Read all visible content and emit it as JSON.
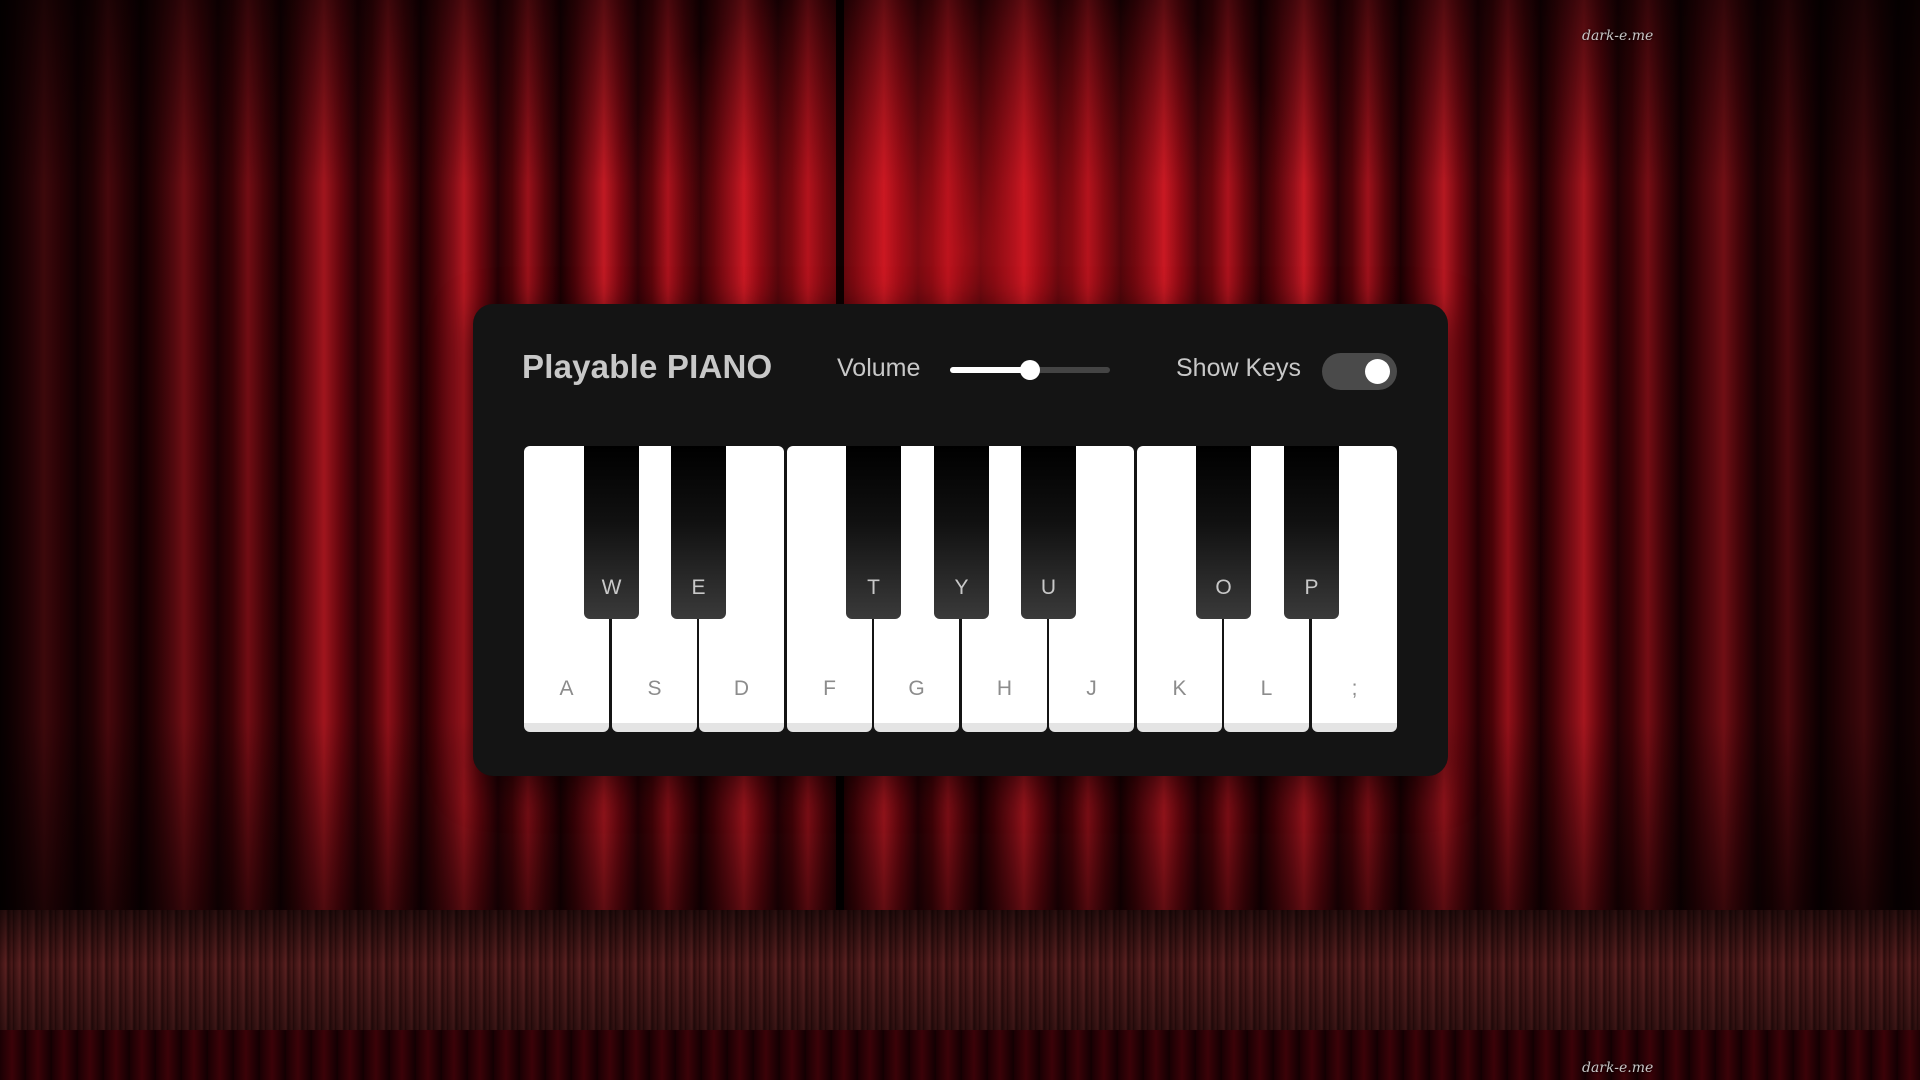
{
  "app": {
    "title": "Playable PIANO",
    "watermark": "dark-e.me"
  },
  "controls": {
    "volume_label": "Volume",
    "volume_value": 0.5,
    "show_keys_label": "Show Keys",
    "show_keys_on": true
  },
  "white_keys": [
    {
      "label": "A"
    },
    {
      "label": "S"
    },
    {
      "label": "D"
    },
    {
      "label": "F"
    },
    {
      "label": "G"
    },
    {
      "label": "H"
    },
    {
      "label": "J"
    },
    {
      "label": "K"
    },
    {
      "label": "L"
    },
    {
      "label": ";"
    }
  ],
  "black_keys": [
    {
      "label": "W"
    },
    {
      "label": "E"
    },
    {
      "label": "T"
    },
    {
      "label": "Y"
    },
    {
      "label": "U"
    },
    {
      "label": "O"
    },
    {
      "label": "P"
    }
  ],
  "colors": {
    "panel_background": "#141414",
    "text": "#c8c8c8",
    "curtain": "#a5121c",
    "white_key": "#ffffff",
    "black_key": "#000000"
  }
}
